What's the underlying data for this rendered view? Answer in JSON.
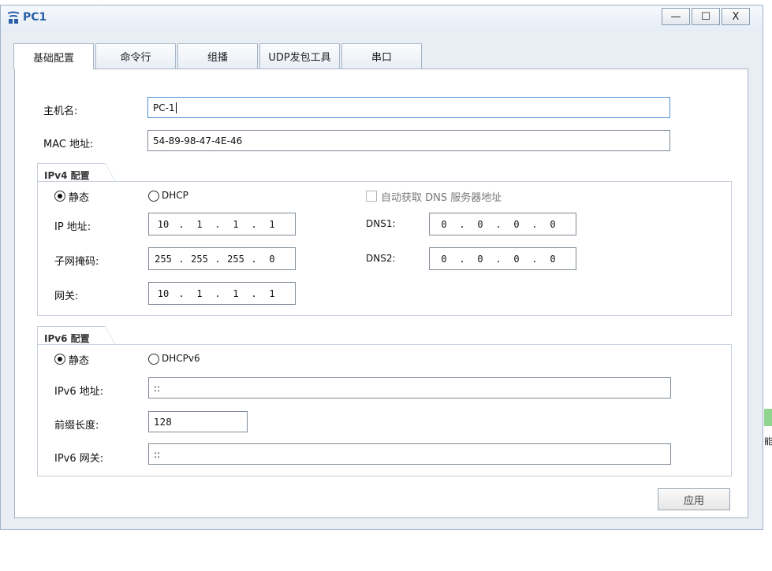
{
  "window": {
    "title": "PC1",
    "minimize_label": "—",
    "maximize_label": "☐",
    "close_label": "X"
  },
  "tabs": [
    {
      "label": "基础配置",
      "active": true
    },
    {
      "label": "命令行",
      "active": false
    },
    {
      "label": "组播",
      "active": false
    },
    {
      "label": "UDP发包工具",
      "active": false
    },
    {
      "label": "串口",
      "active": false
    }
  ],
  "basic": {
    "hostname_label": "主机名:",
    "hostname_value": "PC-1",
    "mac_label": "MAC 地址:",
    "mac_value": "54-89-98-47-4E-46"
  },
  "ipv4": {
    "section_title": "IPv4 配置",
    "static_label": "静态",
    "dhcp_label": "DHCP",
    "mode": "static",
    "auto_dns_label": "自动获取 DNS 服务器地址",
    "auto_dns_checked": false,
    "ip_label": "IP 地址:",
    "ip": [
      "10",
      "1",
      "1",
      "1"
    ],
    "mask_label": "子网掩码:",
    "mask": [
      "255",
      "255",
      "255",
      "0"
    ],
    "gateway_label": "网关:",
    "gateway": [
      "10",
      "1",
      "1",
      "1"
    ],
    "dns1_label": "DNS1:",
    "dns1": [
      "0",
      "0",
      "0",
      "0"
    ],
    "dns2_label": "DNS2:",
    "dns2": [
      "0",
      "0",
      "0",
      "0"
    ]
  },
  "ipv6": {
    "section_title": "IPv6 配置",
    "static_label": "静态",
    "dhcp_label": "DHCPv6",
    "mode": "static",
    "ip_label": "IPv6 地址:",
    "ip_value": "::",
    "prefix_label": "前缀长度:",
    "prefix_value": "128",
    "gateway_label": "IPv6 网关:",
    "gateway_value": "::"
  },
  "apply_label": "应用",
  "side_text": "能",
  "colors": {
    "title_text": "#2a5fa8",
    "focus_border": "#4d90d9",
    "window_bg": "#e9eef5"
  }
}
